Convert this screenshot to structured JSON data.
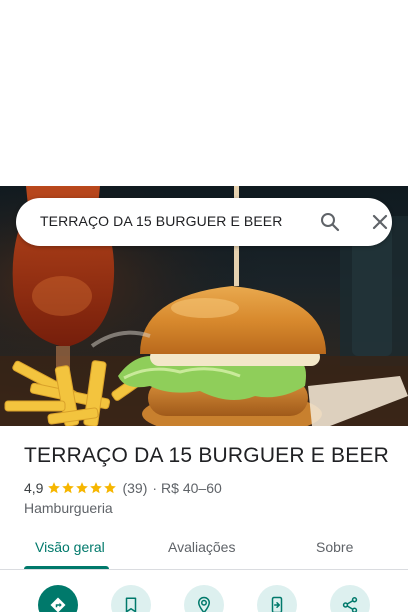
{
  "search": {
    "query": "TERRAÇO DA 15 BURGUER E BEER"
  },
  "hero": {
    "image_subject": "burger-with-fries-and-beer"
  },
  "place": {
    "name": "TERRAÇO DA 15 BURGUER E BEER",
    "rating": "4,9",
    "stars": 5,
    "reviews": "(39)",
    "separator": "·",
    "price_range": "R$ 40–60",
    "category": "Hamburgueria"
  },
  "tabs": [
    {
      "label": "Visão geral",
      "active": true
    },
    {
      "label": "Avaliações",
      "active": false
    },
    {
      "label": "Sobre",
      "active": false
    }
  ],
  "actions": [
    {
      "icon": "directions-icon",
      "primary": true
    },
    {
      "icon": "bookmark-icon",
      "primary": false
    },
    {
      "icon": "nearby-icon",
      "primary": false
    },
    {
      "icon": "send-to-phone-icon",
      "primary": false
    },
    {
      "icon": "share-icon",
      "primary": false
    }
  ],
  "colors": {
    "accent": "#00796b",
    "accent_light": "#ddf0ef",
    "star": "#f6b600",
    "text_primary": "#202124",
    "text_secondary": "#5f6368"
  }
}
